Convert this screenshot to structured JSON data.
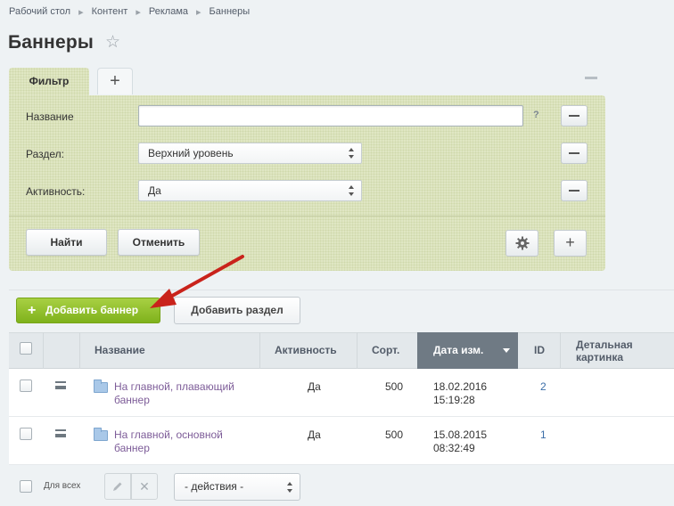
{
  "breadcrumb": [
    "Рабочий стол",
    "Контент",
    "Реклама",
    "Баннеры"
  ],
  "breadcrumb_separator": "▸",
  "page": {
    "title": "Баннеры",
    "star_icon": "star-outline-icon"
  },
  "filter": {
    "tab_label": "Фильтр",
    "add_tab_symbol": "+",
    "fields": [
      {
        "label": "Название",
        "value": "",
        "placeholder": "",
        "help": "?"
      },
      {
        "label": "Раздел:",
        "value": "Верхний уровень"
      },
      {
        "label": "Активность:",
        "value": "Да"
      }
    ],
    "find_label": "Найти",
    "cancel_label": "Отменить",
    "settings_icon": "gear-icon",
    "add_field_symbol": "+"
  },
  "toolbar": {
    "add_banner_label": "Добавить баннер",
    "add_banner_symbol": "+",
    "add_section_label": "Добавить раздел"
  },
  "table": {
    "columns": {
      "name": "Название",
      "active": "Активность",
      "sort": "Сорт.",
      "date": "Дата изм.",
      "id": "ID",
      "picture_line1": "Детальная",
      "picture_line2": "картинка"
    },
    "rows": [
      {
        "name_line1": "На главной, плавающий",
        "name_line2": "баннер",
        "active": "Да",
        "sort": "500",
        "date": "18.02.2016",
        "time": "15:19:28",
        "id": "2"
      },
      {
        "name_line1": "На главной, основной",
        "name_line2": "баннер",
        "active": "Да",
        "sort": "500",
        "date": "15.08.2015",
        "time": "08:32:49",
        "id": "1"
      }
    ],
    "footer": {
      "select_all_label": "Для всех",
      "edit_icon": "pencil-icon",
      "delete_icon": "close-icon",
      "actions_value": "- действия -"
    }
  },
  "colors": {
    "filter_bg": "#dfe6c3",
    "accent_green": "#8bbd22",
    "active_header": "#6f7a84",
    "link_purple": "#7d5c98",
    "annotation_red": "#c9231b"
  }
}
